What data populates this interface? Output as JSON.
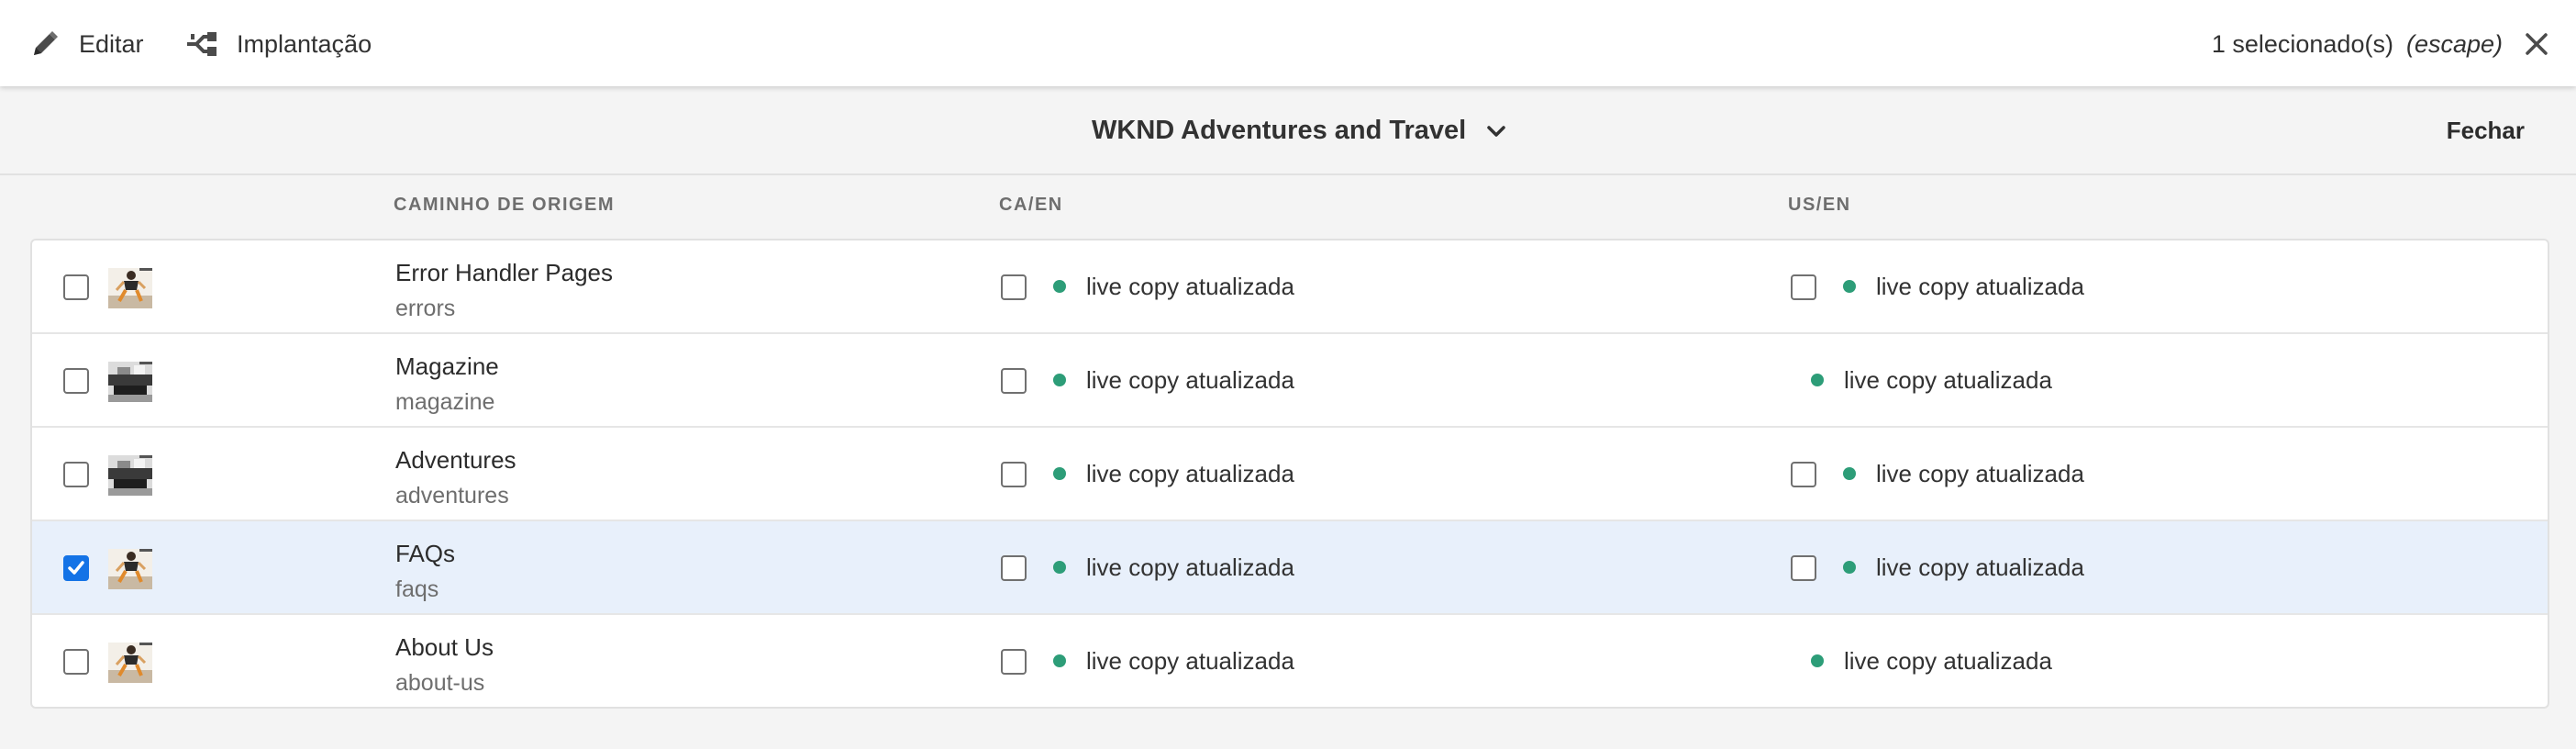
{
  "toolbar": {
    "edit_label": "Editar",
    "deploy_label": "Implantação",
    "selection_count": "1 selecionado(s)",
    "selection_hint": "(escape)"
  },
  "header": {
    "site_title": "WKND Adventures and Travel",
    "close_label": "Fechar"
  },
  "columns": {
    "source": "CAMINHO DE ORIGEM",
    "ca": "CA/EN",
    "us": "US/EN"
  },
  "rows": [
    {
      "title": "Error Handler Pages",
      "path": "errors",
      "ca_status": "live copy atualizada",
      "us_status": "live copy atualizada",
      "selected": false,
      "us_checkbox": true,
      "thumb": "climber"
    },
    {
      "title": "Magazine",
      "path": "magazine",
      "ca_status": "live copy atualizada",
      "us_status": "live copy atualizada",
      "selected": false,
      "us_checkbox": false,
      "thumb": "bw"
    },
    {
      "title": "Adventures",
      "path": "adventures",
      "ca_status": "live copy atualizada",
      "us_status": "live copy atualizada",
      "selected": false,
      "us_checkbox": true,
      "thumb": "bw"
    },
    {
      "title": "FAQs",
      "path": "faqs",
      "ca_status": "live copy atualizada",
      "us_status": "live copy atualizada",
      "selected": true,
      "us_checkbox": true,
      "thumb": "climber"
    },
    {
      "title": "About Us",
      "path": "about-us",
      "ca_status": "live copy atualizada",
      "us_status": "live copy atualizada",
      "selected": false,
      "us_checkbox": false,
      "thumb": "climber"
    }
  ],
  "colors": {
    "accent": "#1473e6",
    "status_ok": "#2d9d78",
    "selected_row": "#e8f0fb"
  },
  "icons": {
    "edit": "pencil-icon",
    "deploy": "rollout-icon",
    "close": "close-icon",
    "dropdown": "chevron-down-icon"
  }
}
